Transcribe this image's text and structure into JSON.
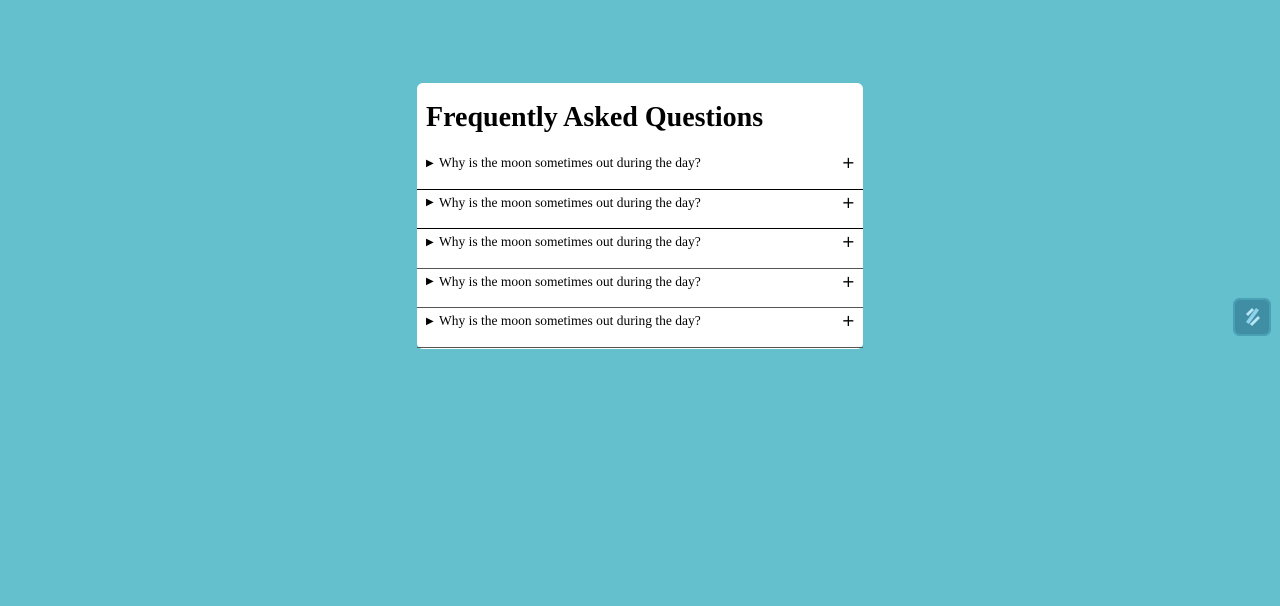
{
  "page": {
    "background_color": "#65c0ce",
    "card_color": "#ffffff"
  },
  "faq": {
    "title": "Frequently Asked Questions",
    "items": [
      {
        "arrow": "▶",
        "question": "Why is the moon sometimes out during the day?",
        "toggle": "+"
      },
      {
        "arrow": "▶",
        "question": "Why is the moon sometimes out during the day?",
        "toggle": "+"
      },
      {
        "arrow": "▶",
        "question": "Why is the moon sometimes out during the day?",
        "toggle": "+"
      },
      {
        "arrow": "▶",
        "question": "Why is the moon sometimes out during the day?",
        "toggle": "+"
      },
      {
        "arrow": "▶",
        "question": "Why is the moon sometimes out during the day?",
        "toggle": "+"
      }
    ]
  },
  "floating_button": {
    "icon": "s-logo-icon",
    "color": "#3f8ea3"
  }
}
